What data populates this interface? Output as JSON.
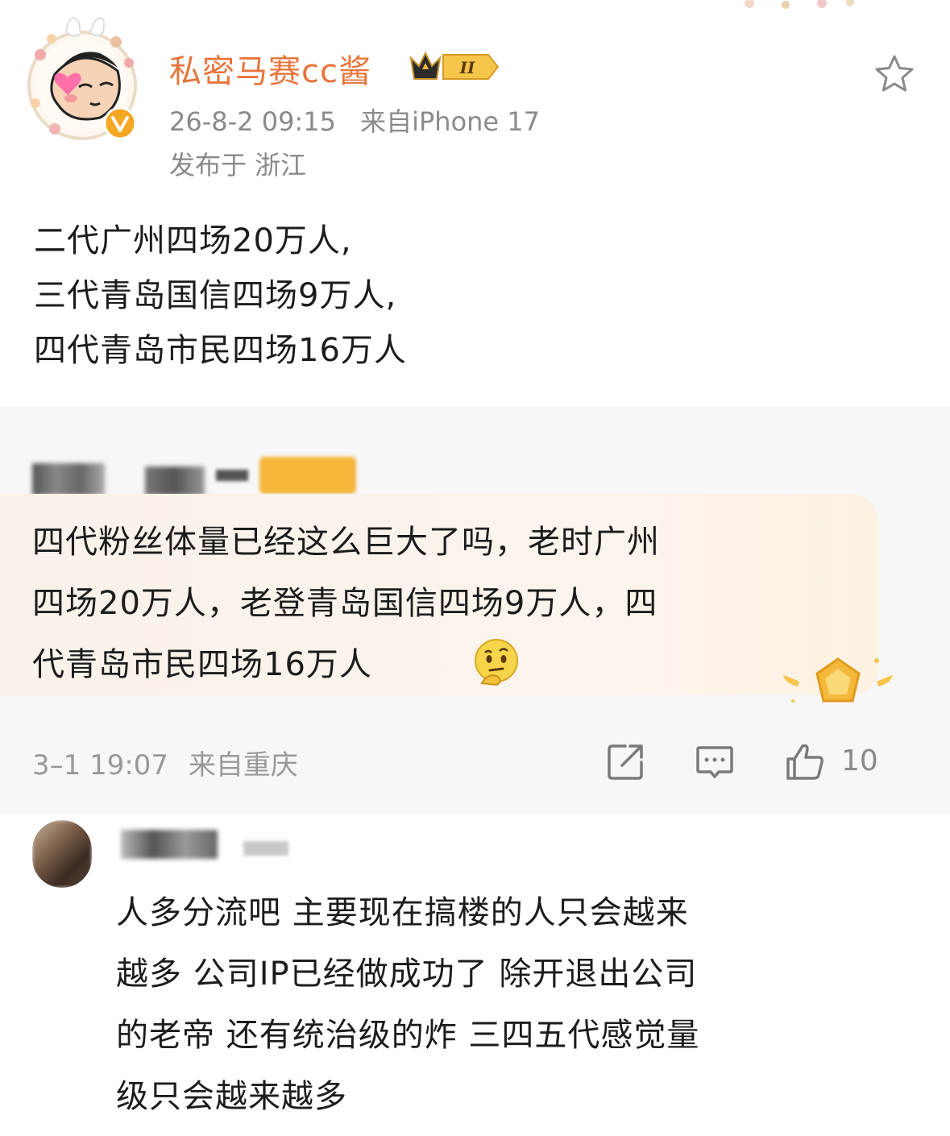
{
  "post": {
    "author": "私密马赛cc酱",
    "rank_badge": "II",
    "time": "26-8-2 09:15",
    "source": "来自iPhone 17",
    "location": "发布于 浙江",
    "body_lines": [
      "二代广州四场20万人,",
      "三代青岛国信四场9万人,",
      "四代青岛市民四场16万人"
    ]
  },
  "comment": {
    "lines": [
      "四代粉丝体量已经这么巨大了吗，老时广州",
      "四场20万人，老登青岛国信四场9万人，四",
      "代青岛市民四场16万人"
    ],
    "timestamp": "3–1 19:07",
    "location": "来自重庆",
    "like_count": "10"
  },
  "reply": {
    "lines": [
      "人多分流吧 主要现在搞楼的人只会越来",
      "越多 公司IP已经做成功了 除开退出公司",
      "的老帝 还有统治级的炸 三四五代感觉量",
      "级只会越来越多"
    ]
  },
  "icons": {
    "favorite": "star-outline-icon",
    "share": "share-icon",
    "comment": "comment-icon",
    "like": "thumbs-up-icon"
  },
  "colors": {
    "username": "#e8743b",
    "meta_gray": "#8a8a8a",
    "comment_card_bg": "#f7f7f7",
    "quote_bg": "#fbf4ec"
  }
}
